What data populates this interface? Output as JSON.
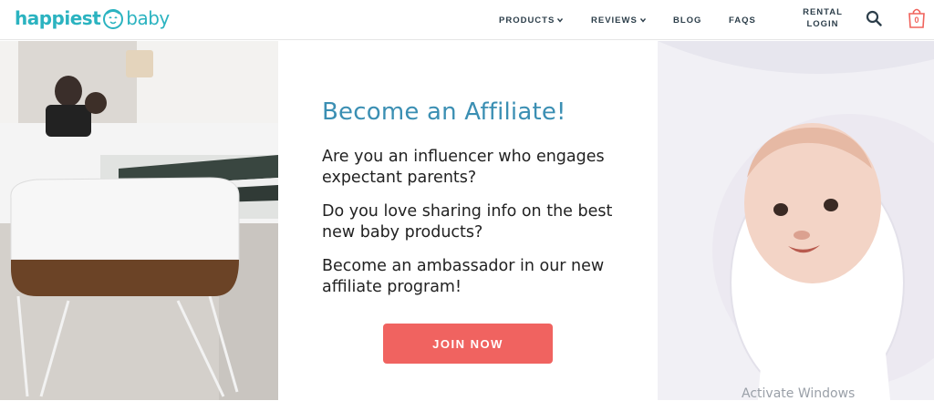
{
  "header": {
    "logo": {
      "part1": "happiest",
      "part2": "baby"
    },
    "nav": {
      "products": "PRODUCTS",
      "reviews": "REVIEWS",
      "blog": "BLOG",
      "faqs": "FAQS",
      "rental_line1": "RENTAL",
      "rental_line2": "LOGIN"
    },
    "cart_count": "0"
  },
  "hero": {
    "headline": "Become an Affiliate!",
    "paragraphs": [
      "Are you an influencer who engages expectant parents?",
      "Do you love sharing info on the best new baby products?",
      "Become an ambassador in our new affiliate program!"
    ],
    "cta_label": "JOIN NOW"
  },
  "colors": {
    "brand": "#2bb3c0",
    "headline": "#3b8fb3",
    "cta": "#f06360",
    "nav_text": "#2c3e4a"
  },
  "overlay": {
    "watermark": "Activate Windows"
  }
}
